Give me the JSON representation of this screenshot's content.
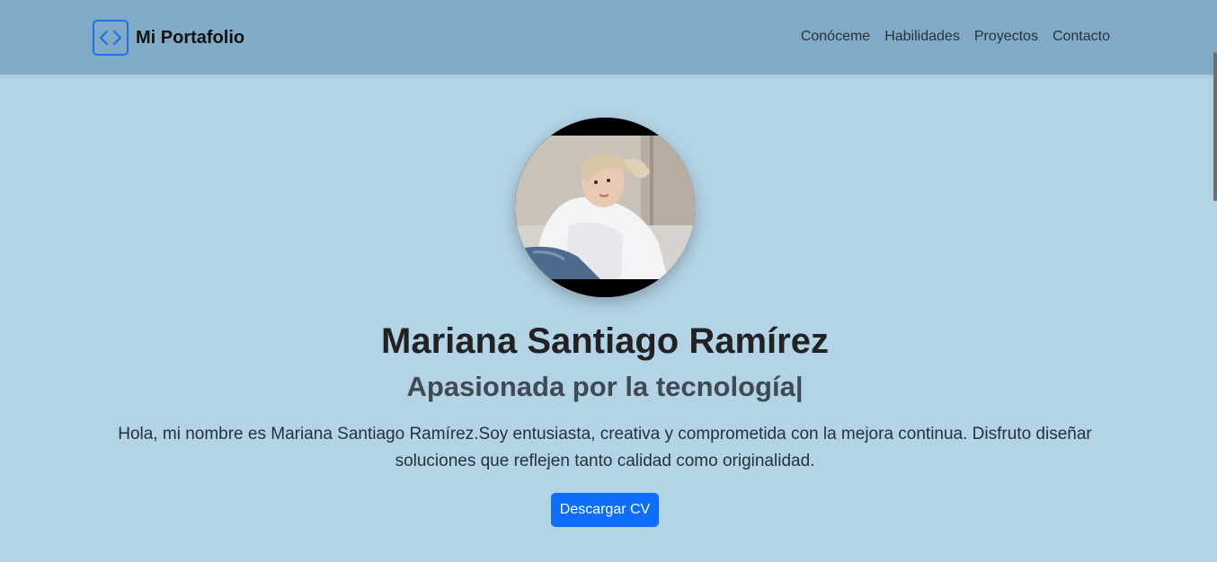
{
  "nav": {
    "brand": "Mi Portafolio",
    "brand_icon": "code-icon",
    "links": [
      "Conóceme",
      "Habilidades",
      "Proyectos",
      "Contacto"
    ]
  },
  "hero": {
    "name": "Mariana Santiago Ramírez",
    "subtitle": "Apasionada por la tecnología|",
    "about": "Hola, mi nombre es Mariana Santiago Ramírez.Soy entusiasta, creativa y comprometida con la mejora continua. Disfruto diseñar soluciones que reflejen tanto calidad como originalidad.",
    "button": "Descargar CV"
  },
  "colors": {
    "navbar": "#81a9c8",
    "background": "#b3d3e6",
    "accent": "#0d6efd"
  }
}
